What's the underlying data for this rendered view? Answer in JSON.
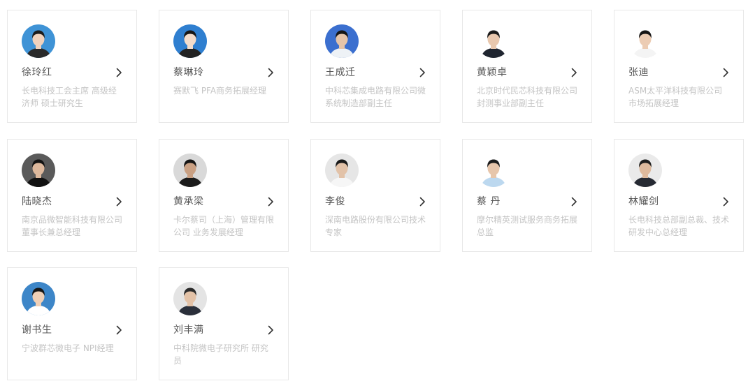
{
  "speakers": [
    {
      "name": "徐玲红",
      "desc": "长电科技工会主席 高级经济师 硕士研究生",
      "avatar": {
        "bg": "#3f93d6",
        "skin": "#f1d2bd",
        "hair": "#1c1c1c",
        "shirt": "#2a2a2a"
      }
    },
    {
      "name": "蔡琳玲",
      "desc": "赛默飞 PFA商务拓展经理",
      "avatar": {
        "bg": "#2f7fd0",
        "skin": "#f3dccb",
        "hair": "#171717",
        "shirt": "#222222"
      }
    },
    {
      "name": "王成迁",
      "desc": "中科芯集成电路有限公司微系统制造部副主任",
      "avatar": {
        "bg": "#3b6fcf",
        "skin": "#e5c4a9",
        "hair": "#161616",
        "shirt": "#eef2f6"
      }
    },
    {
      "name": "黄颖卓",
      "desc": "北京时代民芯科技有限公司 封测事业部副主任",
      "avatar": {
        "bg": "#ffffff",
        "skin": "#e9c8ae",
        "hair": "#1a1a1a",
        "shirt": "#1f2530"
      }
    },
    {
      "name": "张迪",
      "desc": "ASM太平洋科技有限公司市场拓展经理",
      "avatar": {
        "bg": "#ffffff",
        "skin": "#ecccb3",
        "hair": "#151515",
        "shirt": "#f4f4f4"
      }
    },
    {
      "name": "陆晓杰",
      "desc": "南京品微智能科技有限公司 董事长兼总经理",
      "avatar": {
        "bg": "#5a5a5a",
        "skin": "#ddb89c",
        "hair": "#121212",
        "shirt": "#111111"
      }
    },
    {
      "name": "黄承梁",
      "desc": "卡尔蔡司（上海）管理有限公司 业务发展经理",
      "avatar": {
        "bg": "#d9d9d9",
        "skin": "#c9a083",
        "hair": "#141414",
        "shirt": "#1b1b1b"
      }
    },
    {
      "name": "李俊",
      "desc": "深南电路股份有限公司技术专家",
      "avatar": {
        "bg": "#e6e6e6",
        "skin": "#e2c2a8",
        "hair": "#1a1a1a",
        "shirt": "#f6f6f6"
      }
    },
    {
      "name": "蔡 丹",
      "desc": "摩尔精英测试服务商务拓展总监",
      "avatar": {
        "bg": "#ffffff",
        "skin": "#e7c6ab",
        "hair": "#1c1c1c",
        "shirt": "#bcd8ef"
      }
    },
    {
      "name": "林耀剑",
      "desc": "长电科技总部副总裁、技术研发中心总经理",
      "avatar": {
        "bg": "#eaeaea",
        "skin": "#ddb99d",
        "hair": "#1e1e1e",
        "shirt": "#262a33"
      }
    },
    {
      "name": "谢书生",
      "desc": "宁波群芯微电子 NPI经理",
      "avatar": {
        "bg": "#3d86c8",
        "skin": "#efcfb6",
        "hair": "#151515",
        "shirt": "#ffffff"
      }
    },
    {
      "name": "刘丰满",
      "desc": "中科院微电子研究所 研究员",
      "avatar": {
        "bg": "#e4e4e4",
        "skin": "#e3c2a7",
        "hair": "#2a2a2a",
        "shirt": "#2a2f3a"
      }
    }
  ],
  "icons": {
    "avatar": "avatar-portrait",
    "arrow": "chevron-right-icon"
  },
  "colors": {
    "card_border": "#e8e8e8",
    "name_text": "#555555",
    "desc_text": "#c4c4c4",
    "chevron": "#333333"
  }
}
